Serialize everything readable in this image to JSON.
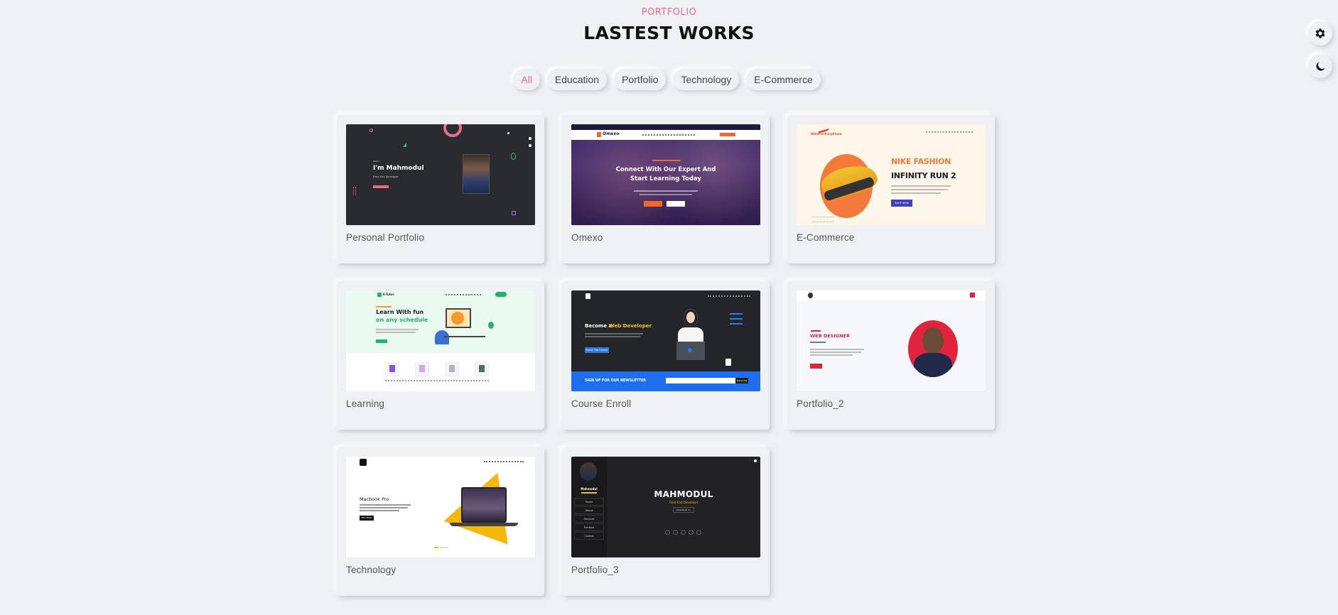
{
  "header": {
    "kicker": "PORTFOLIO",
    "title": "LASTEST WORKS"
  },
  "filters": [
    {
      "label": "All",
      "active": true
    },
    {
      "label": "Education",
      "active": false
    },
    {
      "label": "Portfolio",
      "active": false
    },
    {
      "label": "Technology",
      "active": false
    },
    {
      "label": "E-Commerce",
      "active": false
    }
  ],
  "side_buttons": {
    "settings_icon": "gear-icon",
    "theme_icon": "moon-icon"
  },
  "colors": {
    "background": "#eff0f4",
    "accent": "#ec6b8e",
    "title": "#111111"
  },
  "projects": [
    {
      "title": "Personal Portfolio",
      "preview": {
        "greeting": "I'm Mahmodul",
        "role": "Front End Developer"
      }
    },
    {
      "title": "Omexo",
      "preview": {
        "brand": "Omexo",
        "headline_1": "Connect With Our Expert And",
        "headline_2": "Start Learning Today"
      }
    },
    {
      "title": "E-Commerce",
      "preview": {
        "brand": "NikeFactoryStore",
        "headline_1": "NIKE FASHION",
        "headline_2": "INFINITY RUN 2",
        "button": "SHOP NOW"
      }
    },
    {
      "title": "Learning",
      "preview": {
        "brand": "E-Tutor",
        "headline_1": "Learn With fun",
        "headline_2": "on any schedule"
      }
    },
    {
      "title": "Course Enroll",
      "preview": {
        "headline_1": "Become a",
        "headline_2": "Web Developer",
        "button": "Enroll The Course",
        "newsletter": "SIGN UP FOR OUR NEWSLETTER",
        "subscribe": "Subscribe"
      }
    },
    {
      "title": "Portfolio_2",
      "preview": {
        "headline": "WEB DESIGNER"
      }
    },
    {
      "title": "Technology",
      "preview": {
        "headline": "Macbook Pro",
        "button": "BUY NOW"
      }
    },
    {
      "title": "Portfolio_3",
      "preview": {
        "name": "MAHMODUL",
        "role": "Front End Developer",
        "sidebar_name": "Mahmodul",
        "menu": [
          "Home",
          "About",
          "Services",
          "Portfolio",
          "Contact"
        ],
        "button": "Download Cv"
      }
    }
  ]
}
